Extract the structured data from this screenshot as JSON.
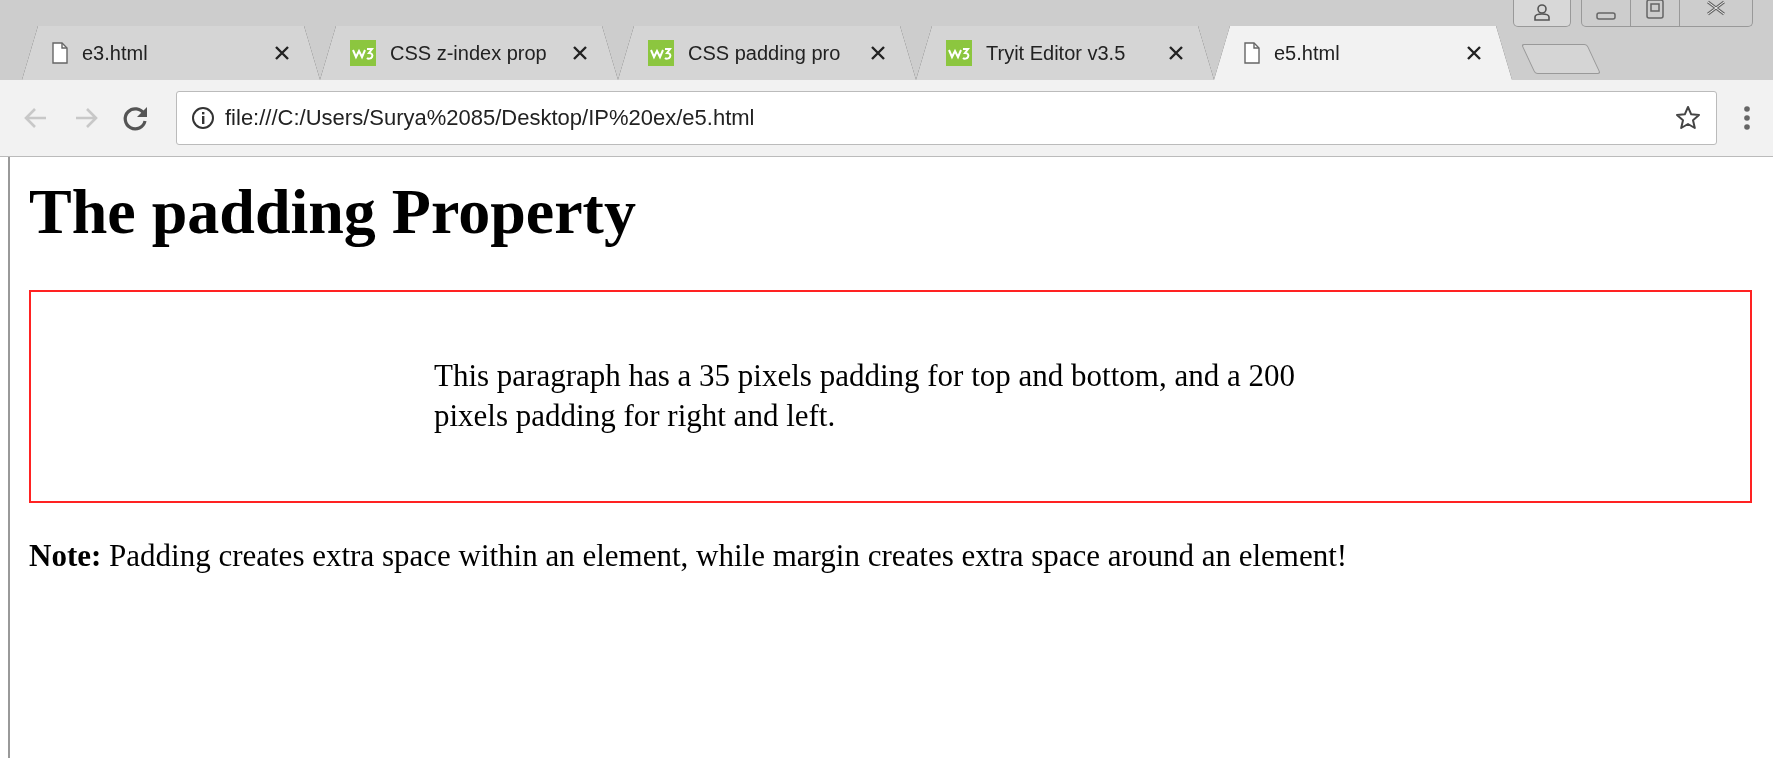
{
  "tabs": [
    {
      "title": "e3.html",
      "kind": "page",
      "selected": false
    },
    {
      "title": "CSS z-index prop",
      "kind": "w3",
      "selected": false
    },
    {
      "title": "CSS padding pro",
      "kind": "w3",
      "selected": false
    },
    {
      "title": "Tryit Editor v3.5",
      "kind": "w3",
      "selected": false
    },
    {
      "title": "e5.html",
      "kind": "page",
      "selected": true
    }
  ],
  "nav_buttons": [
    {
      "kind": "back",
      "disabled": true
    },
    {
      "kind": "forward",
      "disabled": true
    },
    {
      "kind": "reload",
      "disabled": false
    }
  ],
  "address": "file:///C:/Users/Surya%2085/Desktop/IP%20ex/e5.html",
  "page": {
    "heading": "The padding Property",
    "paragraph": "This paragraph has a 35 pixels padding for top and bottom, and a 200 pixels padding for right and left.",
    "note": "**Note:** Padding creates extra space within an element, while margin creates extra space around an element!"
  }
}
